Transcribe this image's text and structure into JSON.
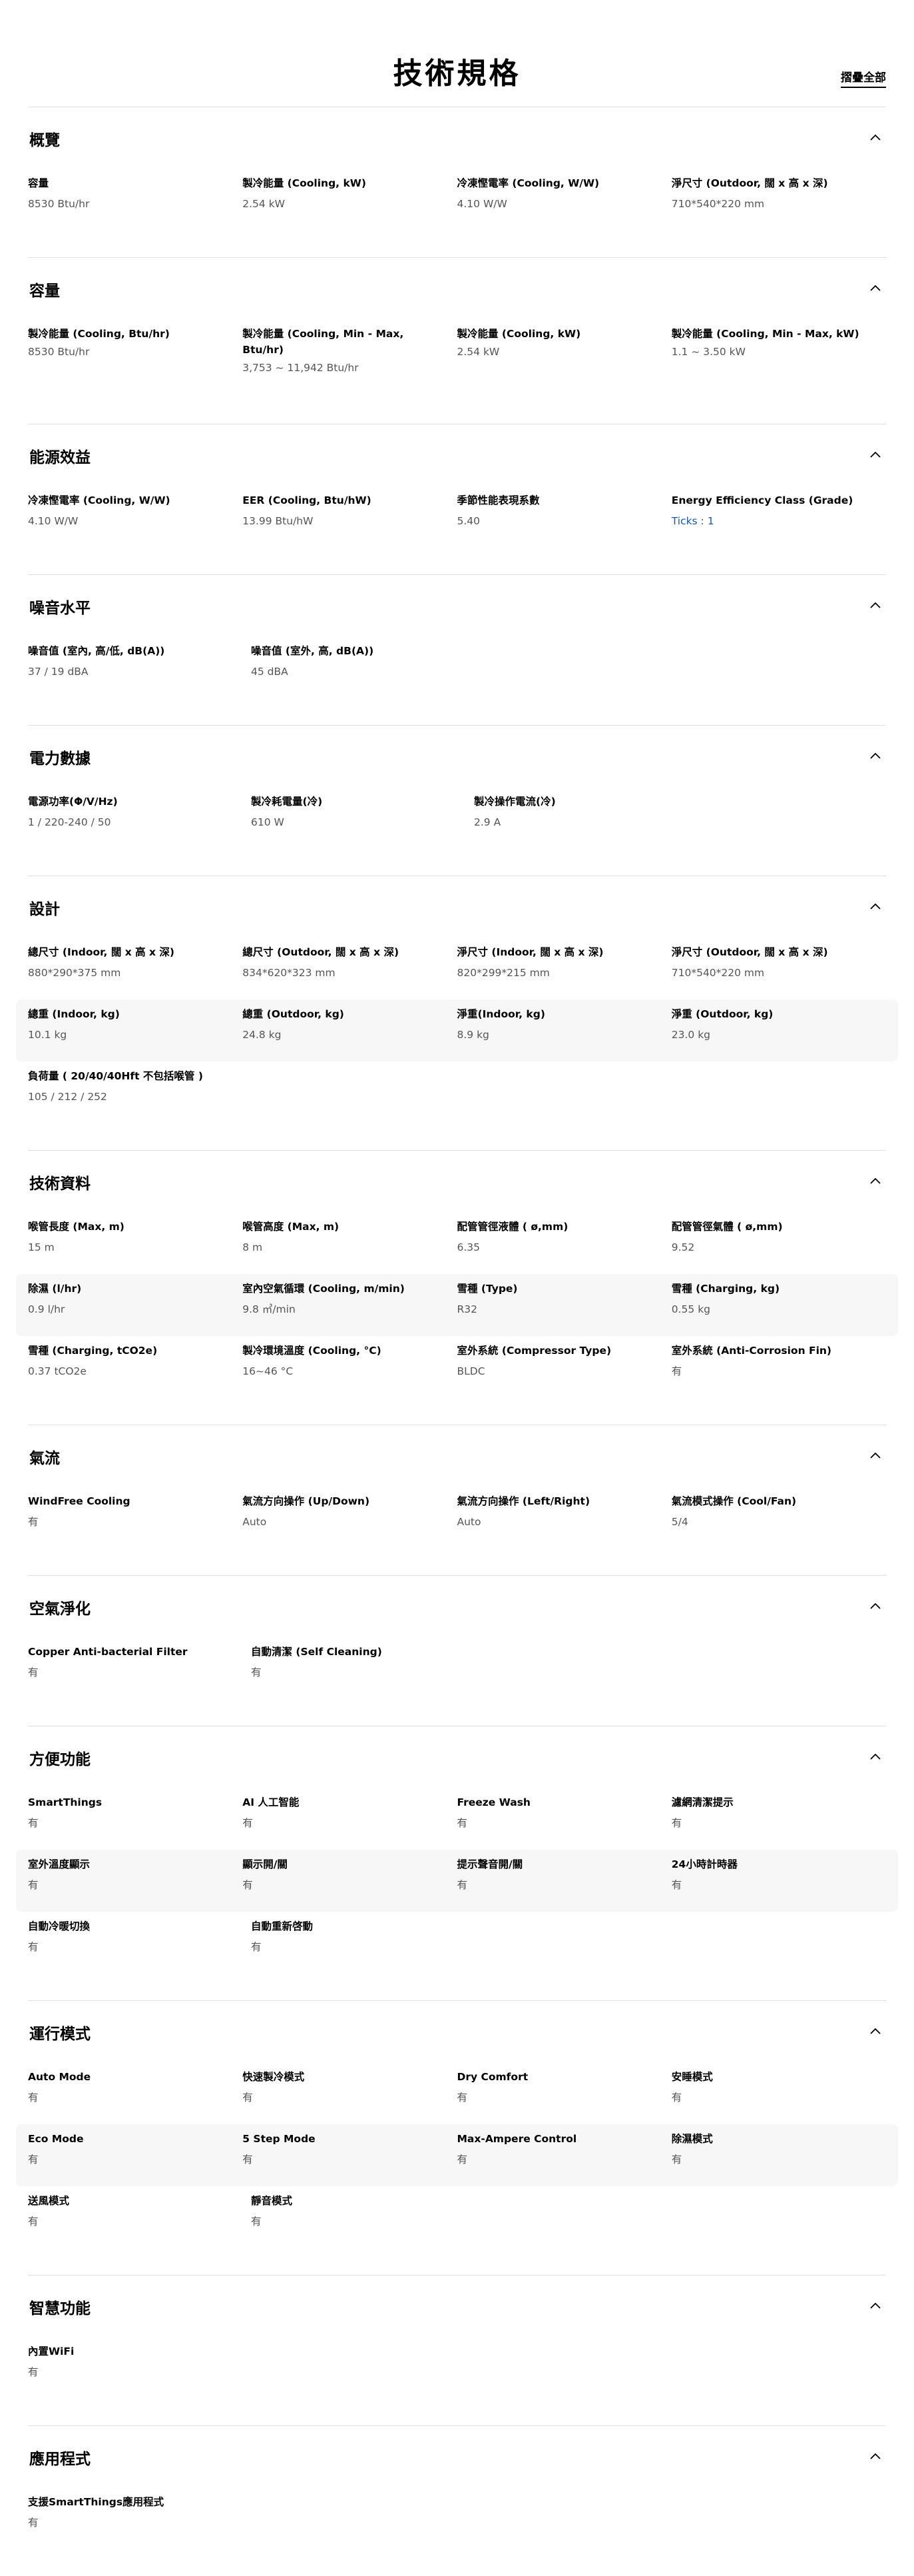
{
  "page": {
    "title": "技術規格",
    "collapse_all": "摺疊全部"
  },
  "sections": [
    {
      "title": "概覽",
      "rows": [
        [
          {
            "label": "容量",
            "value": "8530 Btu/hr"
          },
          {
            "label": "製冷能量 (Cooling, kW)",
            "value": "2.54 kW"
          },
          {
            "label": "冷凍慳電率 (Cooling, W/W)",
            "value": "4.10 W/W"
          },
          {
            "label": "淨尺寸 (Outdoor, 闊 x 高 x 深)",
            "value": "710*540*220 mm"
          }
        ]
      ]
    },
    {
      "title": "容量",
      "rows": [
        [
          {
            "label": "製冷能量 (Cooling, Btu/hr)",
            "value": "8530 Btu/hr"
          },
          {
            "label": "製冷能量 (Cooling, Min - Max, Btu/hr)",
            "value": "3,753 ~ 11,942 Btu/hr"
          },
          {
            "label": "製冷能量 (Cooling, kW)",
            "value": "2.54 kW"
          },
          {
            "label": "製冷能量 (Cooling, Min - Max, kW)",
            "value": "1.1 ~ 3.50 kW"
          }
        ]
      ]
    },
    {
      "title": "能源效益",
      "rows": [
        [
          {
            "label": "冷凍慳電率 (Cooling, W/W)",
            "value": "4.10 W/W"
          },
          {
            "label": "EER (Cooling, Btu/hW)",
            "value": "13.99 Btu/hW"
          },
          {
            "label": "季節性能表現系數",
            "value": "5.40"
          },
          {
            "label": "Energy Efficiency Class (Grade)",
            "value": "Ticks : 1",
            "link": true
          }
        ]
      ]
    },
    {
      "title": "噪音水平",
      "rows": [
        [
          {
            "label": "噪音值 (室內, 高/低, dB(A))",
            "value": "37 / 19 dBA"
          },
          {
            "label": "噪音值 (室外, 高, dB(A))",
            "value": "45 dBA"
          }
        ]
      ]
    },
    {
      "title": "電力數據",
      "rows": [
        [
          {
            "label": "電源功率(Φ/V/Hz)",
            "value": "1 / 220-240 / 50"
          },
          {
            "label": "製冷耗電量(冷)",
            "value": "610 W"
          },
          {
            "label": "製冷操作電流(冷)",
            "value": "2.9 A"
          }
        ]
      ]
    },
    {
      "title": "設計",
      "rows": [
        [
          {
            "label": "總尺寸 (Indoor, 闊 x 高 x 深)",
            "value": "880*290*375 mm"
          },
          {
            "label": "總尺寸 (Outdoor, 闊 x 高 x 深)",
            "value": "834*620*323 mm"
          },
          {
            "label": "淨尺寸 (Indoor, 闊 x 高 x 深)",
            "value": "820*299*215 mm"
          },
          {
            "label": "淨尺寸 (Outdoor, 闊 x 高 x 深)",
            "value": "710*540*220 mm"
          }
        ],
        [
          {
            "label": "總重 (Indoor, kg)",
            "value": "10.1 kg"
          },
          {
            "label": "總重 (Outdoor, kg)",
            "value": "24.8 kg"
          },
          {
            "label": "淨重(Indoor, kg)",
            "value": "8.9 kg"
          },
          {
            "label": "淨重 (Outdoor, kg)",
            "value": "23.0 kg"
          }
        ],
        [
          {
            "label": "負荷量 ( 20/40/40Hft 不包括喉管 )",
            "value": "105 / 212 / 252"
          }
        ]
      ]
    },
    {
      "title": "技術資料",
      "rows": [
        [
          {
            "label": "喉管長度 (Max, m)",
            "value": "15 m"
          },
          {
            "label": "喉管高度 (Max, m)",
            "value": "8 m"
          },
          {
            "label": "配管管徑液體 ( ø,mm)",
            "value": "6.35"
          },
          {
            "label": "配管管徑氣體 ( ø,mm)",
            "value": "9.52"
          }
        ],
        [
          {
            "label": "除濕 (l/hr)",
            "value": "0.9 l/hr"
          },
          {
            "label": "室內空氣循環 (Cooling, m/min)",
            "value": "9.8 ㎥/min"
          },
          {
            "label": "雪種 (Type)",
            "value": "R32"
          },
          {
            "label": "雪種 (Charging, kg)",
            "value": "0.55 kg"
          }
        ],
        [
          {
            "label": "雪種 (Charging, tCO2e)",
            "value": "0.37 tCO2e"
          },
          {
            "label": "製冷環境溫度 (Cooling, °C)",
            "value": "16~46 °C"
          },
          {
            "label": "室外系統 (Compressor Type)",
            "value": "BLDC"
          },
          {
            "label": "室外系統 (Anti-Corrosion Fin)",
            "value": "有"
          }
        ]
      ]
    },
    {
      "title": "氣流",
      "rows": [
        [
          {
            "label": "WindFree Cooling",
            "value": "有"
          },
          {
            "label": "氣流方向操作 (Up/Down)",
            "value": "Auto"
          },
          {
            "label": "氣流方向操作 (Left/Right)",
            "value": "Auto"
          },
          {
            "label": "氣流模式操作 (Cool/Fan)",
            "value": "5/4"
          }
        ]
      ]
    },
    {
      "title": "空氣淨化",
      "rows": [
        [
          {
            "label": "Copper Anti-bacterial Filter",
            "value": "有"
          },
          {
            "label": "自動清潔 (Self Cleaning)",
            "value": "有"
          }
        ]
      ]
    },
    {
      "title": "方便功能",
      "rows": [
        [
          {
            "label": "SmartThings",
            "value": "有"
          },
          {
            "label": "AI 人工智能",
            "value": "有"
          },
          {
            "label": "Freeze Wash",
            "value": "有"
          },
          {
            "label": "濾網清潔提示",
            "value": "有"
          }
        ],
        [
          {
            "label": "室外溫度顯示",
            "value": "有"
          },
          {
            "label": "顯示開/關",
            "value": "有"
          },
          {
            "label": "提示聲音開/關",
            "value": "有"
          },
          {
            "label": "24小時計時器",
            "value": "有"
          }
        ],
        [
          {
            "label": "自動冷暖切換",
            "value": "有"
          },
          {
            "label": "自動重新啓動",
            "value": "有"
          }
        ]
      ]
    },
    {
      "title": "運行模式",
      "rows": [
        [
          {
            "label": "Auto Mode",
            "value": "有"
          },
          {
            "label": "快速製冷模式",
            "value": "有"
          },
          {
            "label": "Dry Comfort",
            "value": "有"
          },
          {
            "label": "安睡模式",
            "value": "有"
          }
        ],
        [
          {
            "label": "Eco Mode",
            "value": "有"
          },
          {
            "label": "5 Step Mode",
            "value": "有"
          },
          {
            "label": "Max-Ampere Control",
            "value": "有"
          },
          {
            "label": "除濕模式",
            "value": "有"
          }
        ],
        [
          {
            "label": "送風模式",
            "value": "有"
          },
          {
            "label": "靜音模式",
            "value": "有"
          }
        ]
      ]
    },
    {
      "title": "智慧功能",
      "rows": [
        [
          {
            "label": "內置WiFi",
            "value": "有"
          }
        ]
      ]
    },
    {
      "title": "應用程式",
      "rows": [
        [
          {
            "label": "支援SmartThings應用程式",
            "value": "有"
          }
        ]
      ]
    }
  ]
}
